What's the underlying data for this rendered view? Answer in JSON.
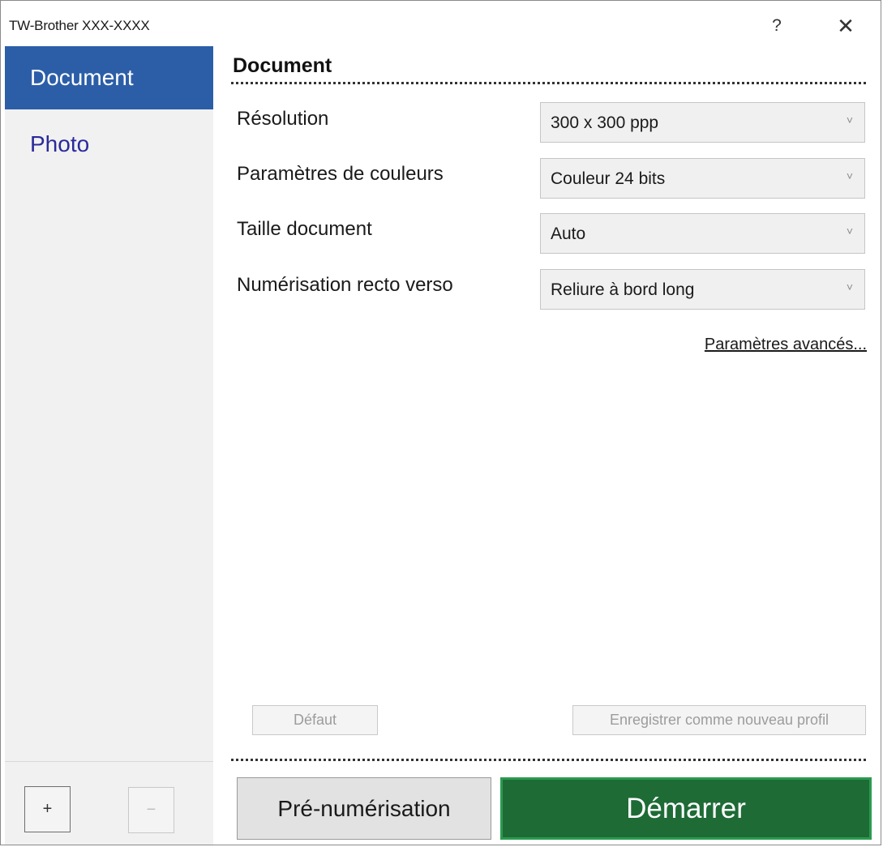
{
  "window": {
    "title": "TW-Brother XXX-XXXX",
    "help_label": "?",
    "close_label": "✕"
  },
  "sidebar": {
    "items": [
      {
        "label": "Document",
        "active": true
      },
      {
        "label": "Photo",
        "active": false
      }
    ],
    "add_label": "+",
    "remove_label": "−"
  },
  "main": {
    "section_title": "Document",
    "settings": [
      {
        "label": "Résolution",
        "value": "300 x 300 ppp"
      },
      {
        "label": "Paramètres de couleurs",
        "value": "Couleur 24 bits"
      },
      {
        "label": "Taille document",
        "value": "Auto"
      },
      {
        "label": "Numérisation recto verso",
        "value": "Reliure à bord long"
      }
    ],
    "chevron": "˅",
    "advanced_link": "Paramètres avancés...",
    "default_button": "Défaut",
    "save_profile_button": "Enregistrer comme nouveau profil",
    "prescan_button": "Pré-numérisation",
    "start_button": "Démarrer"
  },
  "colors": {
    "sidebar_active": "#2c5ea8",
    "sidebar_text": "#2a2a9c",
    "start_button": "#1e6b36",
    "start_border": "#2b9a4f"
  }
}
